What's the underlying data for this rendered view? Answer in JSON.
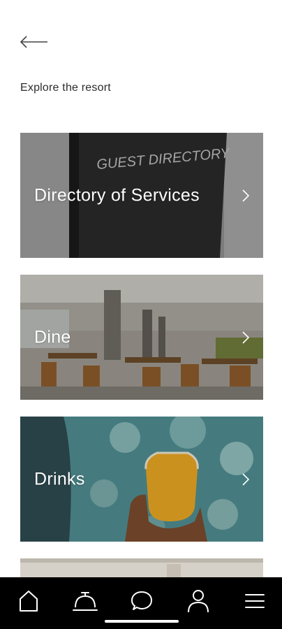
{
  "header": {
    "back_icon": "arrow-left-icon",
    "section_title": "Explore the resort"
  },
  "cards": [
    {
      "label": "Directory of Services",
      "image": "guest-directory-book",
      "book_text": "GUEST DIRECTORY"
    },
    {
      "label": "Dine",
      "image": "restaurant-dining-room"
    },
    {
      "label": "Drinks",
      "image": "hand-holding-orange-drink"
    },
    {
      "label": "",
      "image": "partially-visible-card"
    }
  ],
  "tabbar": {
    "items": [
      "home-icon",
      "concierge-bell-icon",
      "chat-icon",
      "profile-icon",
      "menu-icon"
    ]
  },
  "colors": {
    "background": "#ffffff",
    "tabbar": "#000000",
    "text": "#2b2b2b"
  }
}
